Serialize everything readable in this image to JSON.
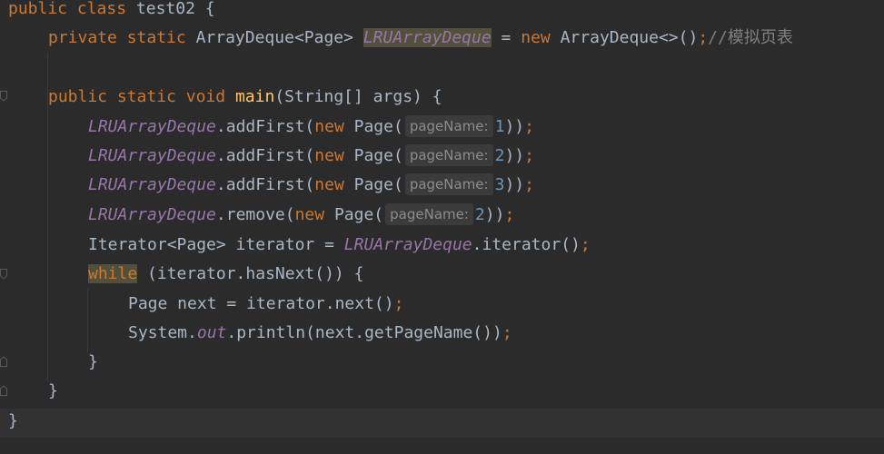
{
  "code": {
    "line1": {
      "kw_public": "public",
      "kw_class": "class",
      "class_name": "test02",
      "brace": "{"
    },
    "line2": {
      "kw_private": "private",
      "kw_static": "static",
      "type": "ArrayDeque<Page>",
      "field_name": "LRUArrayDeque",
      "assign": "=",
      "kw_new": "new",
      "ctor": "ArrayDeque<>()",
      "semi": ";",
      "comment": "//模拟页表"
    },
    "line4": {
      "kw_public": "public",
      "kw_static": "static",
      "kw_void": "void",
      "method_name": "main",
      "params": "(String[] args) {"
    },
    "add_calls": [
      {
        "field": "LRUArrayDeque",
        "call": ".addFirst(",
        "kw_new": "new",
        "ctor": "Page(",
        "hint": "pageName:",
        "value": "1",
        "close": "))",
        "semi": ";"
      },
      {
        "field": "LRUArrayDeque",
        "call": ".addFirst(",
        "kw_new": "new",
        "ctor": "Page(",
        "hint": "pageName:",
        "value": "2",
        "close": "))",
        "semi": ";"
      },
      {
        "field": "LRUArrayDeque",
        "call": ".addFirst(",
        "kw_new": "new",
        "ctor": "Page(",
        "hint": "pageName:",
        "value": "3",
        "close": "))",
        "semi": ";"
      }
    ],
    "remove_call": {
      "field": "LRUArrayDeque",
      "call": ".remove(",
      "kw_new": "new",
      "ctor": "Page(",
      "hint": "pageName:",
      "value": "2",
      "close": "))",
      "semi": ";"
    },
    "iterator_line": {
      "decl": "Iterator<Page> iterator = ",
      "field": "LRUArrayDeque",
      "call": ".iterator()",
      "semi": ";"
    },
    "while_line": {
      "kw_while": "while",
      "cond": " (iterator.hasNext()) {"
    },
    "next_line": {
      "decl": "Page next = iterator.next()",
      "semi": ";"
    },
    "print_line": {
      "system": "System.",
      "out": "out",
      "call": ".println(next.getPageName())",
      "semi": ";"
    },
    "close_while": "}",
    "close_method": "}",
    "close_class": "}"
  },
  "colors": {
    "background": "#2b2b2b",
    "keyword": "#cc7832",
    "method_decl": "#ffc66d",
    "static_field": "#9876aa",
    "number": "#6897bb",
    "comment": "#808080",
    "default_text": "#a9b7c6"
  }
}
